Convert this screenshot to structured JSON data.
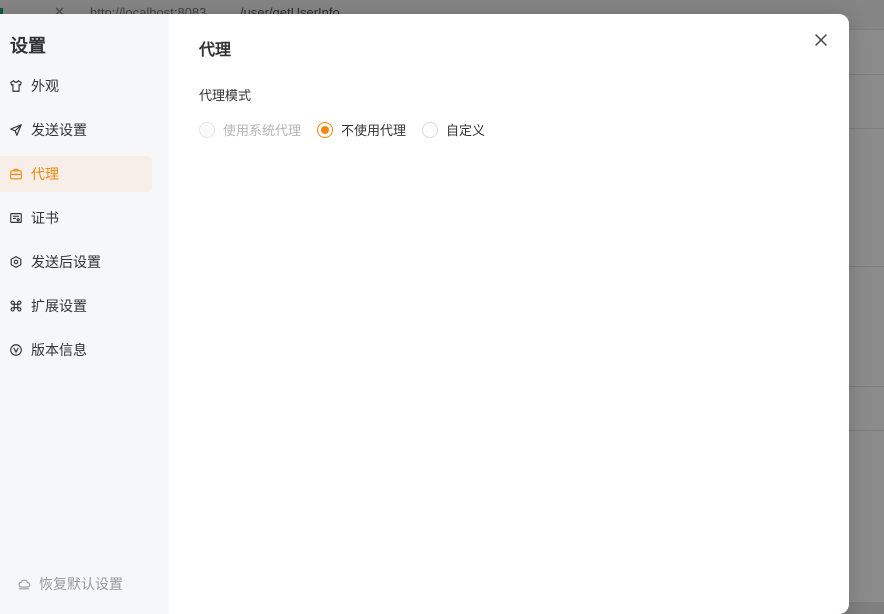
{
  "background": {
    "url_text": "http://localhost:8083",
    "path_text": "/user/getUserInfo"
  },
  "sidebar": {
    "title": "设置",
    "items": [
      {
        "label": "外观",
        "icon": "shirt-icon",
        "active": false
      },
      {
        "label": "发送设置",
        "icon": "send-icon",
        "active": false
      },
      {
        "label": "代理",
        "icon": "briefcase-icon",
        "active": true
      },
      {
        "label": "证书",
        "icon": "certificate-icon",
        "active": false
      },
      {
        "label": "发送后设置",
        "icon": "hexagon-settings-icon",
        "active": false
      },
      {
        "label": "扩展设置",
        "icon": "command-icon",
        "active": false
      },
      {
        "label": "版本信息",
        "icon": "version-icon",
        "active": false
      }
    ],
    "restore_label": "恢复默认设置"
  },
  "content": {
    "title": "代理",
    "field_label": "代理模式",
    "options": [
      {
        "label": "使用系统代理",
        "checked": false,
        "disabled": true
      },
      {
        "label": "不使用代理",
        "checked": true,
        "disabled": false
      },
      {
        "label": "自定义",
        "checked": false,
        "disabled": false
      }
    ]
  },
  "colors": {
    "accent": "#f0870f",
    "active_bg": "#f7efe7",
    "sidebar_bg": "#f6f7f9"
  }
}
